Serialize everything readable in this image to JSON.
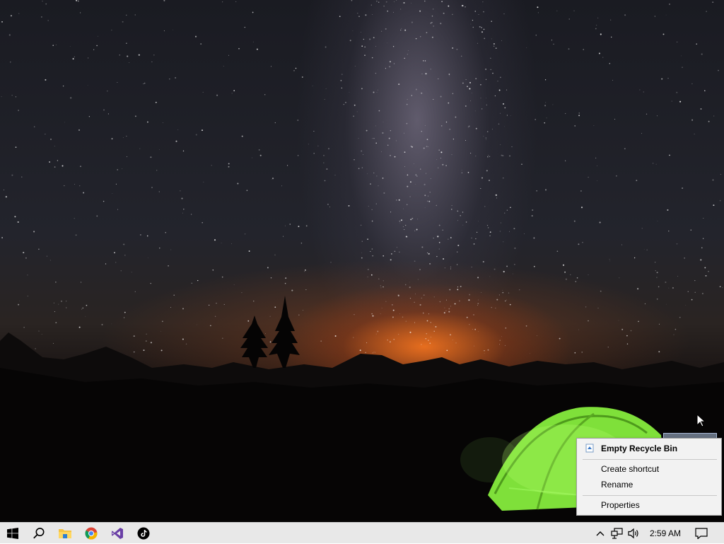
{
  "desktop": {
    "wallpaper": "night sky with milky way, mountain silhouettes and a glowing green tent",
    "accent_colors": {
      "sky": "#1f2027",
      "horizon_glow": "#ff7a1e",
      "tent": "#7fe03a"
    }
  },
  "context_menu": {
    "items": [
      {
        "label": "Empty Recycle Bin",
        "icon": "recycle-bin-icon",
        "default": true
      },
      {
        "label": "Create shortcut"
      },
      {
        "label": "Rename"
      },
      {
        "label": "Properties"
      }
    ]
  },
  "taskbar": {
    "pinned": [
      {
        "name": "start",
        "icon": "windows-logo-icon"
      },
      {
        "name": "search",
        "icon": "search-icon"
      },
      {
        "name": "file-explorer",
        "icon": "folder-icon"
      },
      {
        "name": "chrome",
        "icon": "chrome-icon"
      },
      {
        "name": "visual-studio",
        "icon": "visual-studio-icon"
      },
      {
        "name": "tiktok",
        "icon": "tiktok-icon"
      }
    ],
    "tray": {
      "icons": [
        "chevron-up-icon",
        "network-icon",
        "volume-icon"
      ],
      "clock": "2:59 AM",
      "notification_icon": "notification-icon"
    }
  }
}
